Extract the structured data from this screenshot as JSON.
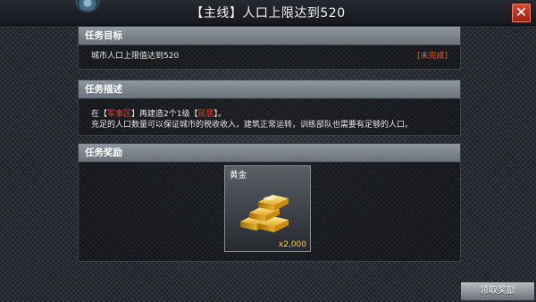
{
  "window": {
    "title": "【主线】人口上限达到520",
    "close_label": "✕"
  },
  "objective": {
    "header": "任务目标",
    "goal": "城市人口上限值达到520",
    "status": "[未完成]"
  },
  "description": {
    "header": "任务描述",
    "line1_prefix": "在【",
    "line1_area": "军事区",
    "line1_middle": "】再建造2个1级【",
    "line1_building": "民居",
    "line1_suffix": "】。",
    "line2": "充足的人口数量可以保证城市的税收收入，建筑正常运转，训练部队也需要有足够的人口。"
  },
  "reward": {
    "header": "任务奖励",
    "item_name": "黄金",
    "item_icon": "gold-bars-icon",
    "quantity": "x2,000"
  },
  "actions": {
    "claim_label": "领取奖励"
  },
  "colors": {
    "status_red": "#e0663a",
    "highlight_red": "#e0463a",
    "quantity_gold": "#f5d046"
  }
}
